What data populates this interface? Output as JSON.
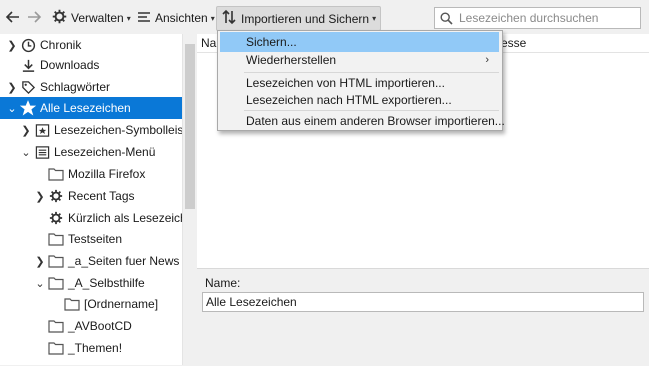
{
  "toolbar": {
    "back_icon": "arrow-left-icon",
    "forward_icon": "arrow-right-icon",
    "organize_label": "Verwalten",
    "views_label": "Ansichten",
    "import_backup_label": "Importieren und Sichern",
    "search_placeholder": "Lesezeichen durchsuchen"
  },
  "sidebar": {
    "items": [
      {
        "label": "Chronik",
        "icon": "clock-icon"
      },
      {
        "label": "Downloads",
        "icon": "download-icon"
      },
      {
        "label": "Schlagwörter",
        "icon": "tag-icon"
      },
      {
        "label": "Alle Lesezeichen",
        "icon": "star-icon",
        "selected": true
      },
      {
        "label": "Lesezeichen-Symbolleiste",
        "icon": "bookmarks-toolbar-icon"
      },
      {
        "label": "Lesezeichen-Menü",
        "icon": "bookmarks-menu-icon"
      },
      {
        "label": "Mozilla Firefox",
        "icon": "folder-icon"
      },
      {
        "label": "Recent Tags",
        "icon": "gear-icon"
      },
      {
        "label": "Kürzlich als Lesezeichen",
        "icon": "gear-icon"
      },
      {
        "label": "Testseiten",
        "icon": "folder-icon"
      },
      {
        "label": "_a_Seiten fuer News",
        "icon": "folder-icon"
      },
      {
        "label": "_A_Selbsthilfe",
        "icon": "folder-icon"
      },
      {
        "label": "[Ordnername]",
        "icon": "folder-icon"
      },
      {
        "label": "_AVBootCD",
        "icon": "folder-icon"
      },
      {
        "label": "_Themen!",
        "icon": "folder-icon"
      }
    ]
  },
  "columns": {
    "name_partial": "Nar",
    "address_partial": "esse"
  },
  "dropdown": {
    "items": [
      {
        "label": "Sichern...",
        "highlighted": true
      },
      {
        "label": "Wiederherstellen",
        "submenu": true
      },
      {
        "label": "Lesezeichen von HTML importieren..."
      },
      {
        "label": "Lesezeichen nach HTML exportieren..."
      },
      {
        "label": "Daten aus einem anderen Browser importieren..."
      }
    ]
  },
  "details": {
    "name_label": "Name:",
    "name_value": "Alle Lesezeichen"
  },
  "colors": {
    "selection": "#0a78d7",
    "menu_highlight": "#91c9f7",
    "folder": "#e8c35c"
  }
}
